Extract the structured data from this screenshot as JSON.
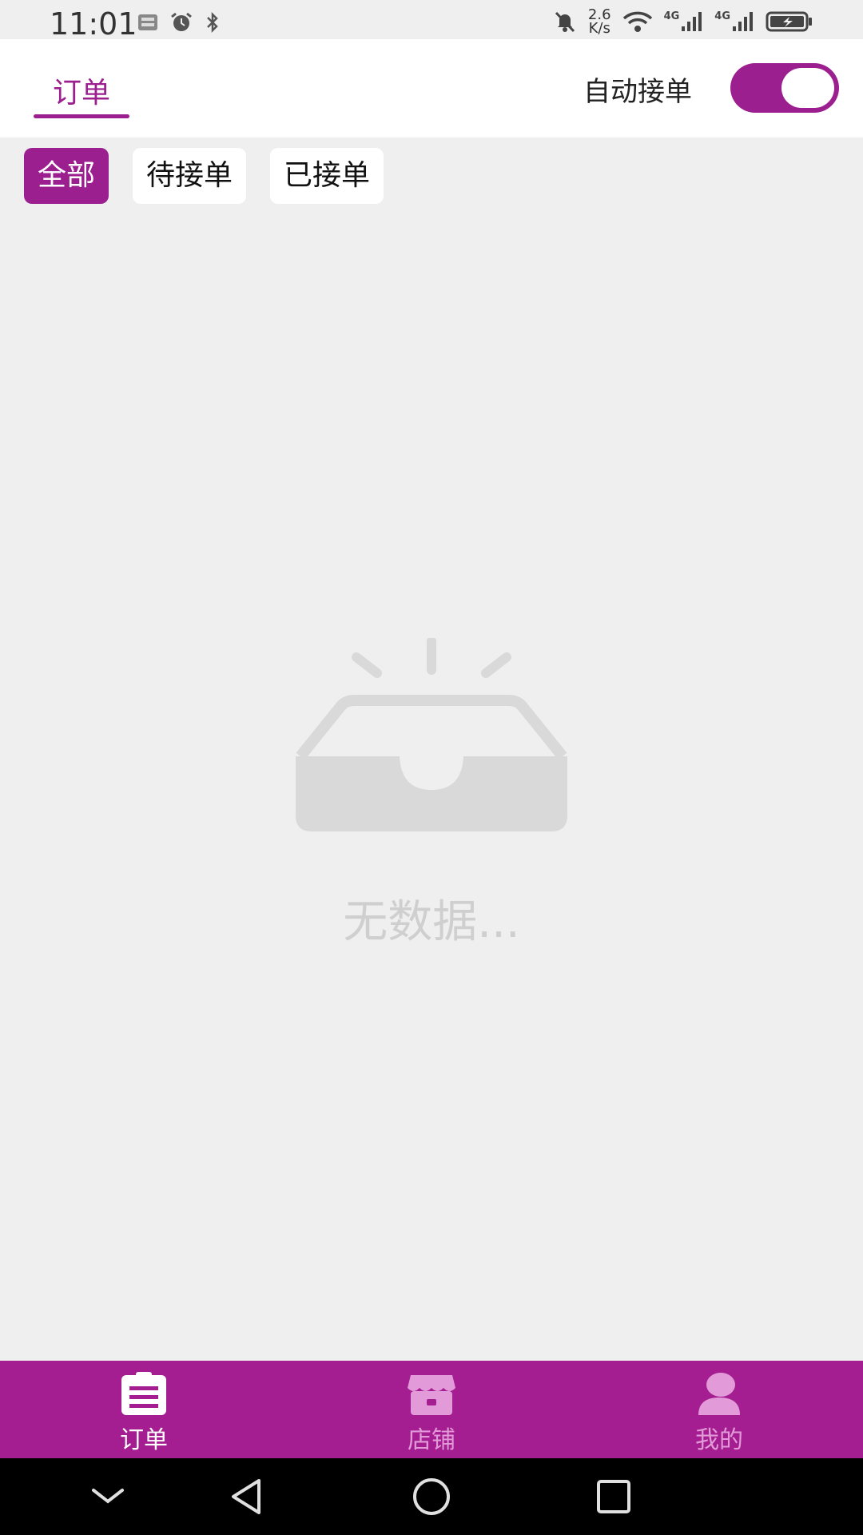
{
  "status_bar": {
    "time": "11:01",
    "net_speed_value": "2.6",
    "net_speed_unit": "K/s",
    "sim1_label": "4G",
    "sim2_label": "4G"
  },
  "header": {
    "tab_label": "订单",
    "auto_accept_label": "自动接单",
    "auto_accept_on": true
  },
  "filters": {
    "all": "全部",
    "pending": "待接单",
    "accepted": "已接单"
  },
  "empty_state": {
    "text": "无数据..."
  },
  "bottom_nav": {
    "orders": "订单",
    "store": "店铺",
    "mine": "我的"
  },
  "colors": {
    "brand": "#9c1f8f",
    "nav_bg": "#a41e91",
    "page_bg": "#efefef"
  },
  "icons": {
    "orders": "clipboard-icon",
    "store": "storefront-icon",
    "mine": "person-icon"
  }
}
